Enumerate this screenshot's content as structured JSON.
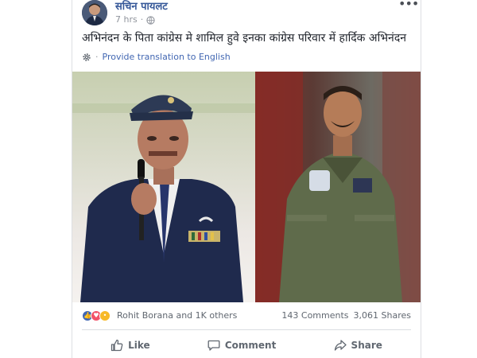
{
  "post": {
    "author": "सचिन पायलट",
    "time": "7 hrs",
    "meta_separator": "·",
    "text": "अभिनंदन के पिता कांग्रेस मे शामिल हुवे इनका कांग्रेस परिवार में हार्दिक अभिनंदन",
    "translate_link": "Provide translation to English",
    "translate_separator": "·"
  },
  "stats": {
    "reactions": [
      "like-icon",
      "love-icon",
      "wow-icon"
    ],
    "likes_text": "Rohit Borana and 1K others",
    "comments_text": "143 Comments",
    "shares_text": "3,061 Shares"
  },
  "actions": {
    "like_label": "Like",
    "comment_label": "Comment",
    "share_label": "Share"
  },
  "colors": {
    "author_link": "#365899",
    "link_blue": "#4267b2",
    "like_blue": "#4267b2",
    "love_red": "#f25268",
    "wow_yellow": "#f7b928"
  }
}
